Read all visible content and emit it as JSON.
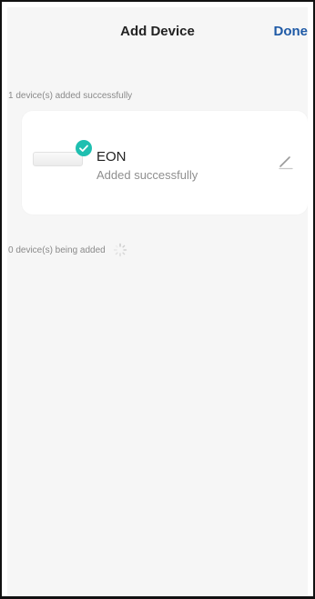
{
  "header": {
    "title": "Add Device",
    "done_label": "Done"
  },
  "added_section": {
    "caption": "1 device(s) added successfully"
  },
  "device": {
    "name": "EON",
    "status": "Added successfully"
  },
  "adding_section": {
    "caption": "0 device(s) being added"
  },
  "icons": {
    "check": "check-icon",
    "edit": "pencil-icon",
    "loading": "loading-spinner-icon"
  },
  "colors": {
    "accent": "#1f5aa6",
    "success": "#1fbfb0"
  }
}
